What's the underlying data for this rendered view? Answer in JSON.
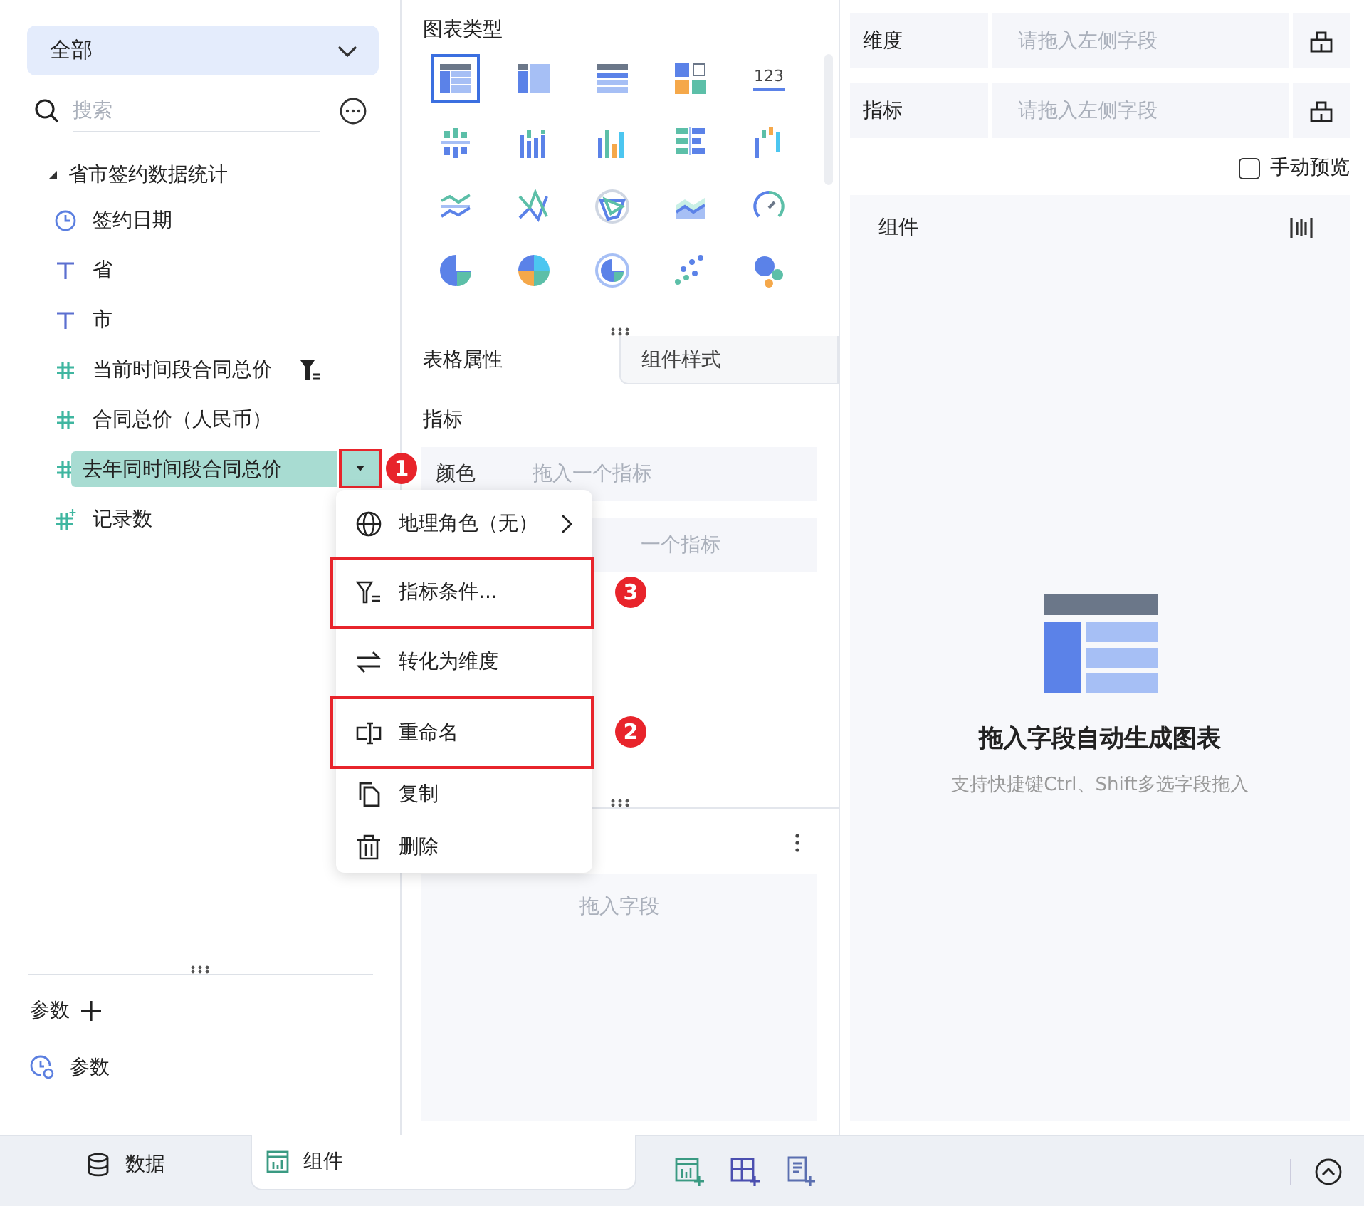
{
  "sidebar": {
    "scope": "全部",
    "search": {
      "placeholder": "搜索"
    },
    "tree": {
      "label": "省市签约数据统计",
      "expanded": true,
      "children": [
        {
          "label": "签约日期",
          "kind": "date",
          "selected": false,
          "filtered": false
        },
        {
          "label": "省",
          "kind": "text",
          "selected": false,
          "filtered": false
        },
        {
          "label": "市",
          "kind": "text",
          "selected": false,
          "filtered": false
        },
        {
          "label": "当前时间段合同总价",
          "kind": "measure",
          "selected": false,
          "filtered": true
        },
        {
          "label": "合同总价（人民币）",
          "kind": "measure",
          "selected": false,
          "filtered": false
        },
        {
          "label": "去年同时间段合同总价",
          "kind": "measure",
          "selected": true,
          "filtered": false,
          "badge": "1"
        },
        {
          "label": "记录数",
          "kind": "count",
          "selected": false,
          "filtered": false
        }
      ]
    },
    "params": {
      "title": "参数",
      "items": [
        {
          "label": "参数"
        }
      ]
    }
  },
  "context_menu": [
    {
      "label": "地理角色（无）",
      "kind": "geo",
      "submenu": true,
      "highlighted": false
    },
    {
      "label": "指标条件...",
      "kind": "filter",
      "submenu": false,
      "highlighted": true,
      "badge": "3"
    },
    {
      "label": "转化为维度",
      "kind": "convert",
      "submenu": false,
      "highlighted": false
    },
    {
      "label": "重命名",
      "kind": "rename",
      "submenu": false,
      "highlighted": true,
      "badge": "2"
    },
    {
      "label": "复制",
      "kind": "copy",
      "submenu": false,
      "highlighted": false
    },
    {
      "label": "删除",
      "kind": "delete",
      "submenu": false,
      "highlighted": false
    }
  ],
  "chart_panel": {
    "title": "图表类型",
    "chart_types": [
      {
        "kind": "table",
        "selected": true
      },
      {
        "kind": "cross",
        "selected": false
      },
      {
        "kind": "detail",
        "selected": false
      },
      {
        "kind": "tile",
        "selected": false
      },
      {
        "kind": "number",
        "label": "123",
        "selected": false
      },
      {
        "kind": "bar1",
        "selected": false
      },
      {
        "kind": "bar2",
        "selected": false
      },
      {
        "kind": "bar3",
        "selected": false
      },
      {
        "kind": "hbar",
        "selected": false
      },
      {
        "kind": "bar4",
        "selected": false
      },
      {
        "kind": "line1",
        "selected": false
      },
      {
        "kind": "line2",
        "selected": false
      },
      {
        "kind": "radar",
        "selected": false
      },
      {
        "kind": "area",
        "selected": false
      },
      {
        "kind": "gauge",
        "selected": false
      },
      {
        "kind": "pie",
        "selected": false
      },
      {
        "kind": "pie2",
        "selected": false
      },
      {
        "kind": "ring",
        "selected": false
      },
      {
        "kind": "scatter",
        "selected": false
      },
      {
        "kind": "bubble",
        "selected": false
      }
    ],
    "tabs": [
      {
        "label": "表格属性",
        "selected": true
      },
      {
        "label": "组件样式",
        "selected": false
      }
    ],
    "section": "指标",
    "rows": [
      {
        "label": "颜色",
        "placeholder": "拖入一个指标"
      },
      {
        "placeholder": "一个指标"
      }
    ],
    "drop_placeholder": "拖入字段"
  },
  "right_panel": {
    "shelves": [
      {
        "label": "维度",
        "placeholder": "请拖入左侧字段"
      },
      {
        "label": "指标",
        "placeholder": "请拖入左侧字段"
      }
    ],
    "manual_preview": {
      "label": "手动预览",
      "checked": false
    },
    "component": {
      "title": "组件",
      "empty_title": "拖入字段自动生成图表",
      "empty_hint": "支持快捷键Ctrl、Shift多选字段拖入"
    }
  },
  "bottom_tabs": [
    {
      "label": "数据",
      "kind": "data",
      "selected": false
    },
    {
      "label": "组件",
      "kind": "component",
      "selected": true
    }
  ]
}
